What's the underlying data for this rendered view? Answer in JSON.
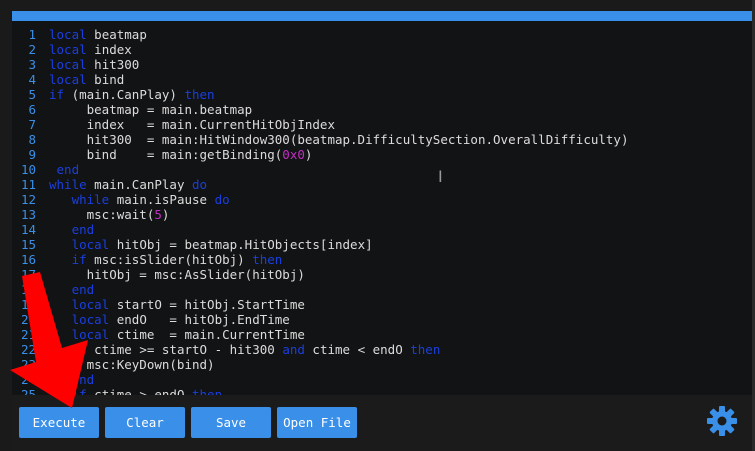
{
  "editor": {
    "lines": [
      {
        "n": "1",
        "parts": [
          [
            "kw",
            "local"
          ],
          [
            "t",
            " beatmap"
          ]
        ]
      },
      {
        "n": "2",
        "parts": [
          [
            "kw",
            "local"
          ],
          [
            "t",
            " index"
          ]
        ]
      },
      {
        "n": "3",
        "parts": [
          [
            "kw",
            "local"
          ],
          [
            "t",
            " hit300"
          ]
        ]
      },
      {
        "n": "4",
        "parts": [
          [
            "kw",
            "local"
          ],
          [
            "t",
            " bind"
          ]
        ]
      },
      {
        "n": "5",
        "parts": [
          [
            "kw",
            "if"
          ],
          [
            "t",
            " (main.CanPlay) "
          ],
          [
            "kw",
            "then"
          ]
        ]
      },
      {
        "n": "6",
        "parts": [
          [
            "t",
            "     beatmap = main.beatmap"
          ]
        ]
      },
      {
        "n": "7",
        "parts": [
          [
            "t",
            "     index   = main.CurrentHitObjIndex"
          ]
        ]
      },
      {
        "n": "8",
        "parts": [
          [
            "t",
            "     hit300  = main:HitWindow300(beatmap.DifficultySection.OverallDifficulty)"
          ]
        ]
      },
      {
        "n": "9",
        "parts": [
          [
            "t",
            "     bind    = main:getBinding("
          ],
          [
            "num",
            "0x0"
          ],
          [
            "t",
            ")"
          ]
        ]
      },
      {
        "n": "10",
        "parts": [
          [
            "t",
            " "
          ],
          [
            "kw",
            "end"
          ]
        ]
      },
      {
        "n": "11",
        "parts": [
          [
            "kw",
            "while"
          ],
          [
            "t",
            " main.CanPlay "
          ],
          [
            "kw",
            "do"
          ]
        ]
      },
      {
        "n": "12",
        "parts": [
          [
            "t",
            "   "
          ],
          [
            "kw",
            "while"
          ],
          [
            "t",
            " main.isPause "
          ],
          [
            "kw",
            "do"
          ]
        ]
      },
      {
        "n": "13",
        "parts": [
          [
            "t",
            "     msc:wait("
          ],
          [
            "num",
            "5"
          ],
          [
            "t",
            ")"
          ]
        ]
      },
      {
        "n": "14",
        "parts": [
          [
            "t",
            "   "
          ],
          [
            "kw",
            "end"
          ]
        ]
      },
      {
        "n": "15",
        "parts": [
          [
            "t",
            "   "
          ],
          [
            "kw",
            "local"
          ],
          [
            "t",
            " hitObj = beatmap.HitObjects[index]"
          ]
        ]
      },
      {
        "n": "16",
        "parts": [
          [
            "t",
            "   "
          ],
          [
            "kw",
            "if"
          ],
          [
            "t",
            " msc:isSlider(hitObj) "
          ],
          [
            "kw",
            "then"
          ]
        ]
      },
      {
        "n": "17",
        "parts": [
          [
            "t",
            "     hitObj = msc:AsSlider(hitObj)"
          ]
        ]
      },
      {
        "n": "18",
        "parts": [
          [
            "t",
            "   "
          ],
          [
            "kw",
            "end"
          ]
        ]
      },
      {
        "n": "19",
        "parts": [
          [
            "t",
            "   "
          ],
          [
            "kw",
            "local"
          ],
          [
            "t",
            " startO = hitObj.StartTime"
          ]
        ]
      },
      {
        "n": "20",
        "parts": [
          [
            "t",
            "   "
          ],
          [
            "kw",
            "local"
          ],
          [
            "t",
            " endO   = hitObj.EndTime"
          ]
        ]
      },
      {
        "n": "21",
        "parts": [
          [
            "t",
            "   "
          ],
          [
            "kw",
            "local"
          ],
          [
            "t",
            " ctime  = main.CurrentTime"
          ]
        ]
      },
      {
        "n": "22",
        "parts": [
          [
            "t",
            "   "
          ],
          [
            "kw",
            "if"
          ],
          [
            "t",
            " ctime >= startO - hit300 "
          ],
          [
            "kw",
            "and"
          ],
          [
            "t",
            " ctime < endO "
          ],
          [
            "kw",
            "then"
          ]
        ]
      },
      {
        "n": "23",
        "parts": [
          [
            "t",
            "     msc:KeyDown(bind)"
          ]
        ]
      },
      {
        "n": "24",
        "parts": [
          [
            "t",
            "   "
          ],
          [
            "kw",
            "end"
          ]
        ]
      },
      {
        "n": "25",
        "parts": [
          [
            "t",
            "   "
          ],
          [
            "kw",
            "if"
          ],
          [
            "t",
            " ctime > endO "
          ],
          [
            "kw",
            "then"
          ]
        ]
      }
    ]
  },
  "toolbar": {
    "execute_label": "Execute",
    "clear_label": "Clear",
    "save_label": "Save",
    "open_label": "Open File"
  },
  "icons": {
    "settings": "gear-icon",
    "caret": "text-cursor-icon",
    "annotation": "red-arrow-annotation"
  },
  "colors": {
    "accent": "#3a8fe8",
    "keyword": "#1a3fe0",
    "number": "#c22ec2",
    "annotation": "#ff0000"
  }
}
